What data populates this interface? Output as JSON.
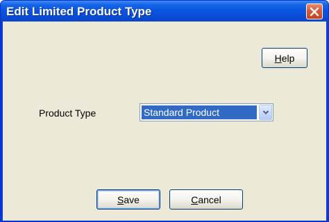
{
  "window": {
    "title": "Edit Limited Product Type"
  },
  "toolbar": {
    "help_label_mnemonic": "H",
    "help_label_rest": "elp"
  },
  "form": {
    "product_type_label": "Product Type",
    "product_type_value": "Standard Product"
  },
  "footer": {
    "save_mnemonic": "S",
    "save_rest": "ave",
    "cancel_mnemonic": "C",
    "cancel_rest": "ancel"
  },
  "icons": {
    "close": "close-icon",
    "dropdown": "chevron-down-icon"
  },
  "colors": {
    "title_bar": "#0a4fd9",
    "close_button": "#d9583a",
    "dialog_body": "#ece9d8",
    "selection": "#316ac5"
  }
}
